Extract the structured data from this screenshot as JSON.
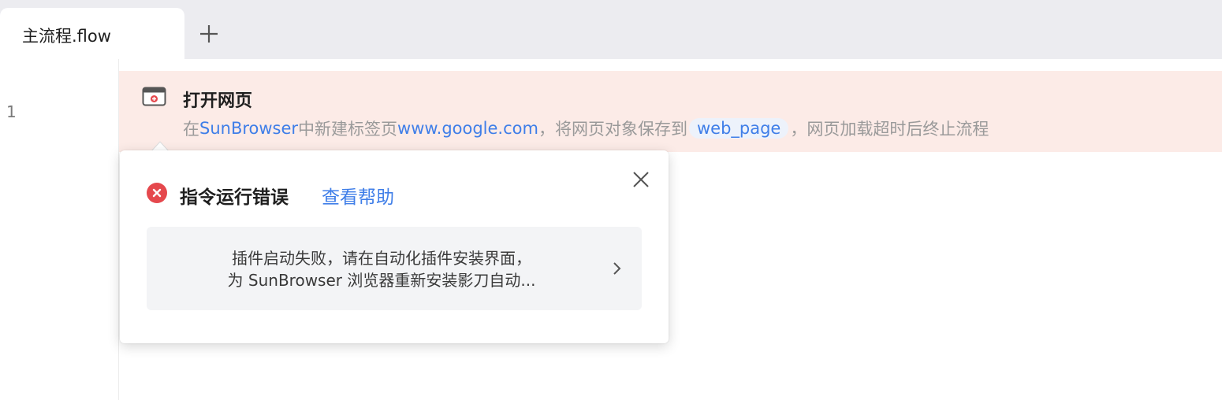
{
  "tabs": {
    "active_tab_label": "主流程.flow",
    "add_tab_icon": "plus-icon"
  },
  "editor": {
    "line_number": "1",
    "command": {
      "icon": "browser-window-icon",
      "title": "打开网页",
      "desc_prefix": "在",
      "browser_name": "SunBrowser",
      "desc_mid1": "中新建标签页",
      "url": "www.google.com",
      "desc_mid2": "，将网页对象保存到",
      "variable": "web_page",
      "desc_suffix": "，网页加载超时后终止流程"
    }
  },
  "error_popover": {
    "icon": "error-circle-icon",
    "title": "指令运行错误",
    "help_link": "查看帮助",
    "close_icon": "close-icon",
    "message_line1": "插件启动失败，请在自动化插件安装界面，",
    "message_line2": "为 SunBrowser 浏览器重新安装影刀自动...",
    "message_chevron_icon": "chevron-right-icon"
  },
  "colors": {
    "tabbar_bg": "#ececf0",
    "error_row_bg": "#fcebe7",
    "link_blue": "#3f7ee8",
    "error_red": "#e5484d",
    "message_bg": "#f3f4f6"
  }
}
